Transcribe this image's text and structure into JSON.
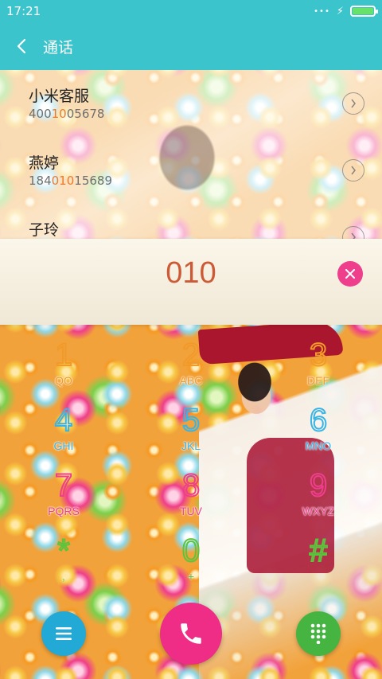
{
  "status_bar": {
    "time": "17:21",
    "signal_icon": "signal-dots-icon",
    "charging_icon": "lightning-icon",
    "battery_icon": "battery-icon",
    "battery_level": 1.0,
    "battery_color": "#66e26a"
  },
  "header": {
    "back_icon": "chevron-left-icon",
    "title": "通话",
    "color": "#3cc4cc"
  },
  "contacts": [
    {
      "name": "小米客服",
      "number_pre": "400",
      "number_match": "10",
      "number_post": "05678"
    },
    {
      "name": "燕婷",
      "number_pre": "184",
      "number_match": "010",
      "number_post": "15689"
    },
    {
      "name": "子玲",
      "number_pre": "",
      "number_match": "",
      "number_post": ""
    }
  ],
  "dialer": {
    "input_value": "010",
    "clear_icon": "close-icon"
  },
  "keypad": [
    {
      "digit": "1",
      "letters": "QO",
      "color": "orange"
    },
    {
      "digit": "2",
      "letters": "ABC",
      "color": "orange"
    },
    {
      "digit": "3",
      "letters": "DEF",
      "color": "orange"
    },
    {
      "digit": "4",
      "letters": "GHI",
      "color": "blue"
    },
    {
      "digit": "5",
      "letters": "JKL",
      "color": "blue"
    },
    {
      "digit": "6",
      "letters": "MNO",
      "color": "blue"
    },
    {
      "digit": "7",
      "letters": "PQRS",
      "color": "pink"
    },
    {
      "digit": "8",
      "letters": "TUV",
      "color": "pink"
    },
    {
      "digit": "9",
      "letters": "WXYZ",
      "color": "pink"
    },
    {
      "digit": "*",
      "letters": ",",
      "color": "green"
    },
    {
      "digit": "0",
      "letters": "+",
      "color": "green"
    },
    {
      "digit": "#",
      "letters": "",
      "color": "green"
    }
  ],
  "actions": {
    "menu_icon": "menu-icon",
    "call_icon": "phone-icon",
    "dialpad_icon": "dialpad-icon",
    "colors": {
      "menu": "#22a9d6",
      "call": "#ef2d86",
      "dialpad": "#45b441"
    }
  }
}
